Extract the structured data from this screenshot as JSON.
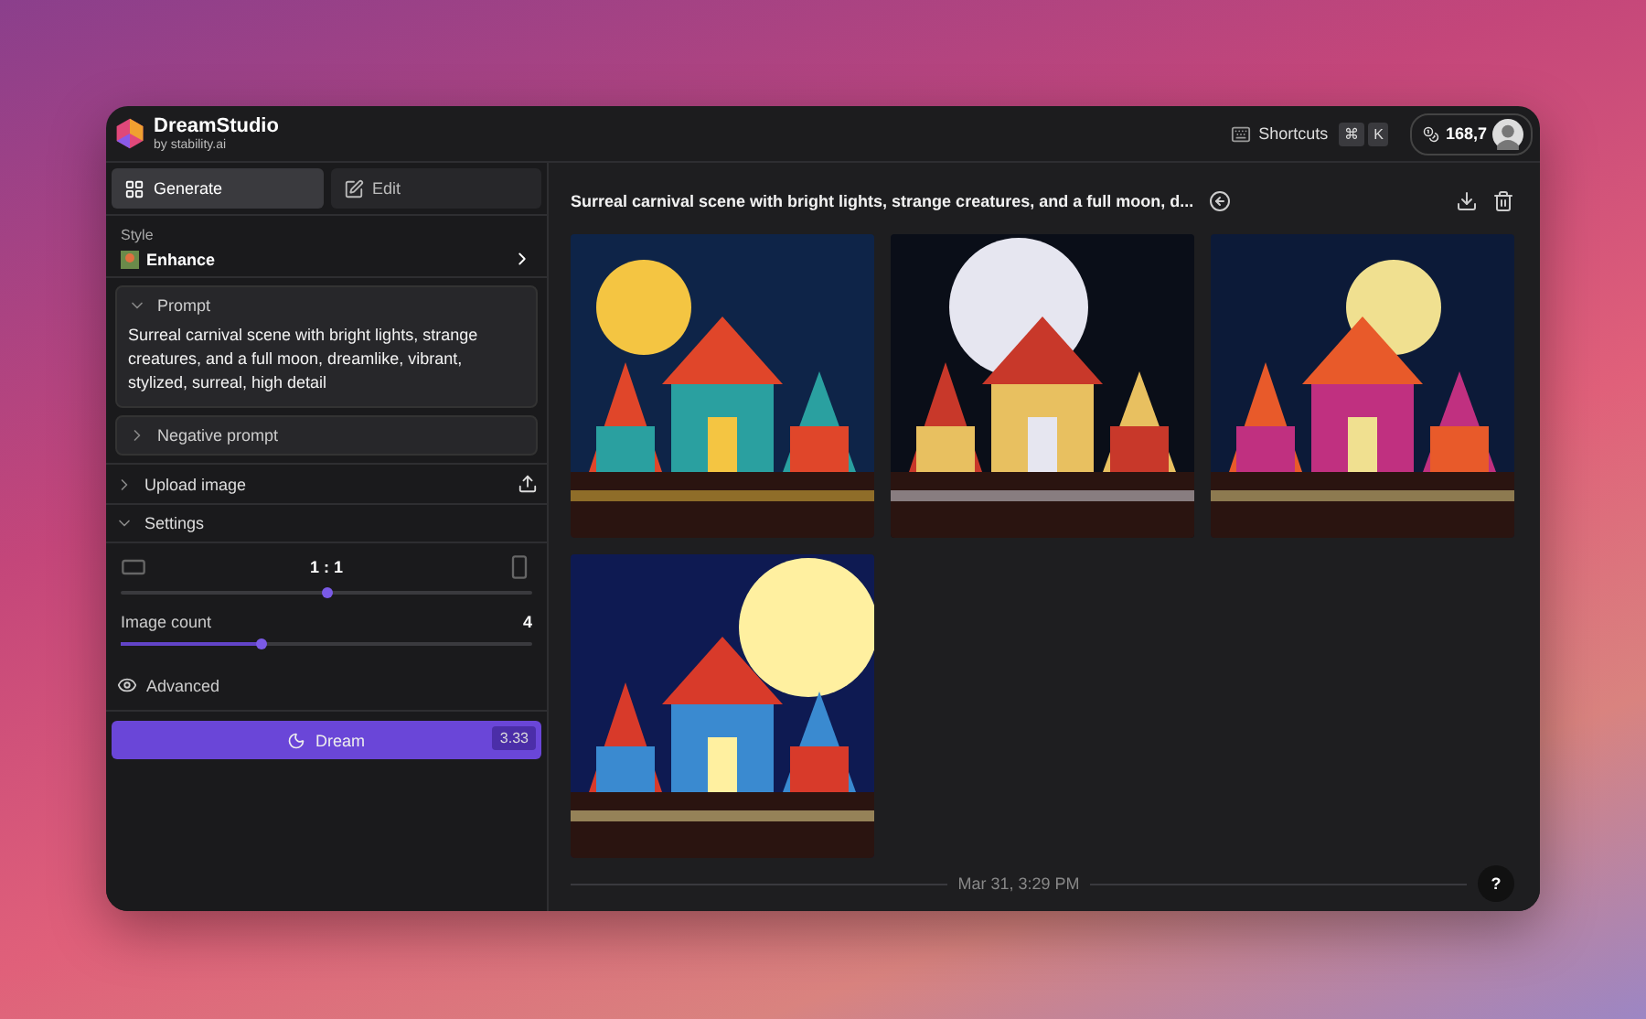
{
  "app": {
    "name": "DreamStudio",
    "byline": "by stability.ai"
  },
  "header": {
    "shortcuts": "Shortcuts",
    "keys": [
      "⌘",
      "K"
    ],
    "credits": "168,7"
  },
  "modes": [
    {
      "label": "Generate",
      "selected": true
    },
    {
      "label": "Edit",
      "selected": false
    }
  ],
  "style": {
    "label": "Style",
    "value": "Enhance"
  },
  "prompt": {
    "label": "Prompt",
    "expanded": true,
    "text": "Surreal carnival scene with bright lights, strange creatures, and a full moon, dreamlike, vibrant, stylized, surreal, high detail"
  },
  "negative_prompt": {
    "label": "Negative prompt",
    "expanded": false
  },
  "upload": {
    "label": "Upload image",
    "expanded": false
  },
  "settings": {
    "label": "Settings",
    "expanded": true,
    "aspect": {
      "value": "1 : 1",
      "level": 0.5
    },
    "count": {
      "label": "Image count",
      "value": "4",
      "level": 0.34
    },
    "advanced": "Advanced"
  },
  "dream": {
    "label": "Dream",
    "cost": "3.33"
  },
  "result": {
    "title": "Surreal carnival scene with bright lights, strange creatures, and a full moon, d...",
    "timestamp": "Mar 31, 3:29 PM"
  },
  "help": "?"
}
